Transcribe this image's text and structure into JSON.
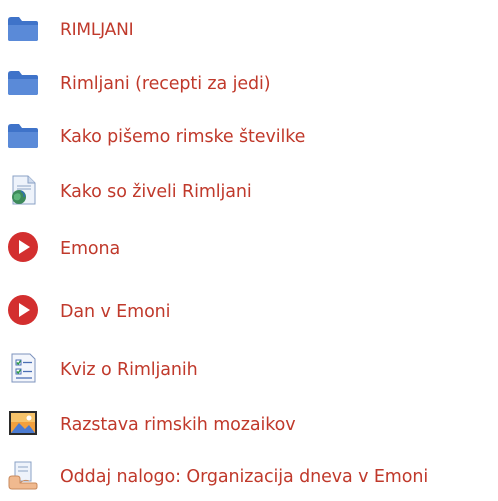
{
  "theme": {
    "link_color": "#c0392b",
    "folder_color": "#3f73c9",
    "play_color": "#d32f2f"
  },
  "activities": [
    {
      "icon": "folder-icon",
      "label": "RIMLJANI"
    },
    {
      "icon": "folder-icon",
      "label": "Rimljani (recepti za jedi)"
    },
    {
      "icon": "folder-icon",
      "label": "Kako pišemo rimske številke"
    },
    {
      "icon": "web-page-icon",
      "label": "Kako so živeli Rimljani"
    },
    {
      "icon": "play-video-icon",
      "label": "Emona"
    },
    {
      "icon": "play-video-icon",
      "label": "Dan v Emoni"
    },
    {
      "icon": "quiz-icon",
      "label": "Kviz o Rimljanih"
    },
    {
      "icon": "image-icon",
      "label": "Razstava rimskih mozaikov"
    },
    {
      "icon": "assignment-icon",
      "label": "Oddaj nalogo: Organizacija dneva v Emoni"
    }
  ]
}
